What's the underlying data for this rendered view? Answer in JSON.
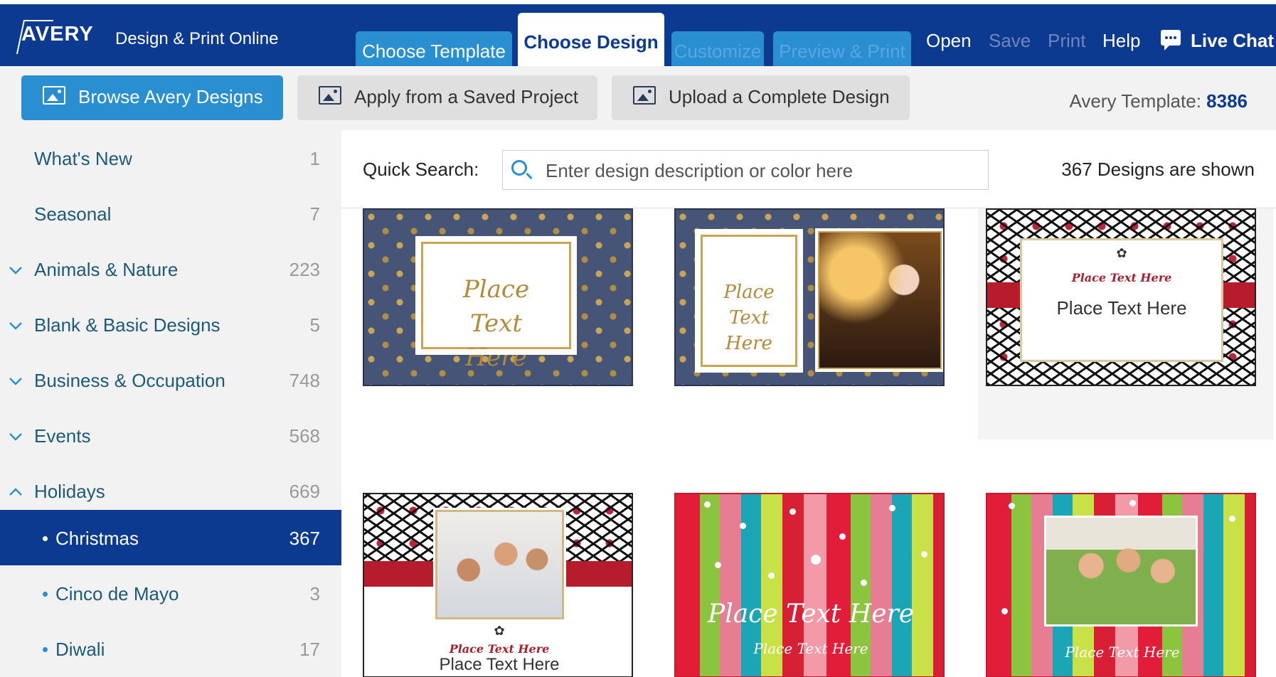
{
  "header": {
    "logo": "AVERY",
    "app_title": "Design & Print Online",
    "tabs": [
      {
        "label": "Choose Template"
      },
      {
        "label": "Choose Design"
      },
      {
        "label": "Customize"
      },
      {
        "label": "Preview & Print"
      }
    ],
    "menu": {
      "open": "Open",
      "save": "Save",
      "print": "Print",
      "help": "Help",
      "live_chat": "Live Chat"
    }
  },
  "actions": {
    "browse": "Browse Avery Designs",
    "apply": "Apply from a Saved Project",
    "upload": "Upload a Complete Design",
    "template_label": "Avery Template:",
    "template_number": "8386"
  },
  "sidebar": {
    "categories": [
      {
        "label": "What's New",
        "count": "1"
      },
      {
        "label": "Seasonal",
        "count": "7"
      },
      {
        "label": "Animals & Nature",
        "count": "223"
      },
      {
        "label": "Blank & Basic Designs",
        "count": "5"
      },
      {
        "label": "Business & Occupation",
        "count": "748"
      },
      {
        "label": "Events",
        "count": "568"
      },
      {
        "label": "Holidays",
        "count": "669"
      },
      {
        "label": "Christmas",
        "count": "367"
      },
      {
        "label": "Cinco de Mayo",
        "count": "3"
      },
      {
        "label": "Diwali",
        "count": "17"
      }
    ]
  },
  "search": {
    "label": "Quick Search:",
    "placeholder": "Enter design description or color here",
    "shown": "367 Designs are shown"
  },
  "designs": {
    "card1_text": "Place Text Here",
    "card2_text": "Place Text Here",
    "card3_title": "Place Text Here",
    "card3_text": "Place Text Here",
    "card4_title": "Place Text Here",
    "card4_text": "Place Text Here",
    "card5_title": "Place Text Here",
    "card5_sub": "Place Text Here",
    "card6_sub": "Place Text Here"
  },
  "colors": {
    "brand_navy": "#0d3a91",
    "accent_blue": "#2a8fd1"
  }
}
